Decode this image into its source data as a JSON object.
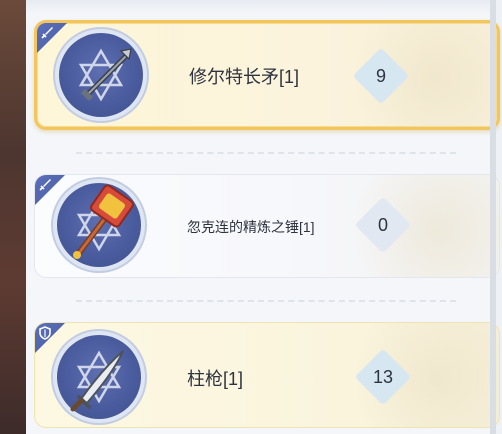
{
  "items": [
    {
      "name": "修尔特长矛[1]",
      "count": "9",
      "badge_icon": "sword-icon",
      "weapon_icon": "spear-icon",
      "state": "selected"
    },
    {
      "name": "忽克连的精炼之锤[1]",
      "count": "0",
      "badge_icon": "sword-icon",
      "weapon_icon": "hammer-icon",
      "state": "normal"
    },
    {
      "name": "柱枪[1]",
      "count": "13",
      "badge_icon": "shield-icon",
      "weapon_icon": "blade-icon",
      "state": "normal"
    }
  ],
  "colors": {
    "selected_border": "#f2c65c",
    "badge_blue": "#4b5ea6",
    "orb_blue": "#4a5c9e",
    "count_diamond": "#d7e7f2"
  }
}
